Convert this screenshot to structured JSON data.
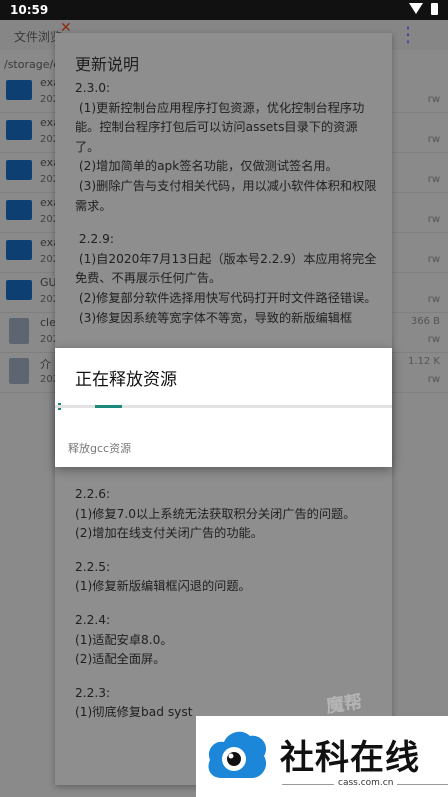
{
  "status_bar": {
    "time": "10:59"
  },
  "background": {
    "tab_label": "文件浏览",
    "path": "/storage/e",
    "rows": [
      {
        "name": "exa",
        "date": "202",
        "perm": "rw",
        "type": "folder",
        "size": ""
      },
      {
        "name": "exa",
        "date": "202",
        "perm": "rw",
        "type": "folder",
        "size": ""
      },
      {
        "name": "exa",
        "date": "202",
        "perm": "rw",
        "type": "folder",
        "size": ""
      },
      {
        "name": "exa",
        "date": "202",
        "perm": "rw",
        "type": "folder",
        "size": ""
      },
      {
        "name": "exa",
        "date": "202",
        "perm": "rw",
        "type": "folder",
        "size": ""
      },
      {
        "name": "GU",
        "date": "202",
        "perm": "rw",
        "type": "folder",
        "size": ""
      },
      {
        "name": "cle",
        "date": "202",
        "perm": "rw",
        "type": "code",
        "size": "366 B"
      },
      {
        "name": "介",
        "date": "202",
        "perm": "rw",
        "type": "file",
        "size": "1.12 K"
      }
    ]
  },
  "changelog": {
    "title": "更新说明",
    "upper_paragraphs": [
      {
        "gap": false,
        "text": "2.3.0:\n (1)更新控制台应用程序打包资源，优化控制台程序功能。控制台程序打包后可以访问assets目录下的资源了。\n (2)增加简单的apk签名功能，仅做测试签名用。\n (3)删除广告与支付相关代码，用以减小软件体积和权限需求。"
      },
      {
        "gap": true,
        "text": " 2.2.9:\n (1)自2020年7月13日起（版本号2.2.9）本应用将完全免费、不再展示任何广告。\n (2)修复部分软件选择用快写代码打开时文件路径错误。\n (3)修复因系统等宽字体不等宽，导致的新版编辑框"
      }
    ],
    "lower_paragraphs": [
      {
        "gap": false,
        "text": "2.2.6:"
      },
      {
        "gap": false,
        "text": "(1)修复7.0以上系统无法获取积分关闭广告的问题。"
      },
      {
        "gap": false,
        "text": "(2)增加在线支付关闭广告的功能。"
      },
      {
        "gap": true,
        "text": "2.2.5:"
      },
      {
        "gap": false,
        "text": "(1)修复新版编辑框闪退的问题。"
      },
      {
        "gap": true,
        "text": "2.2.4:"
      },
      {
        "gap": false,
        "text": "(1)适配安卓8.0。"
      },
      {
        "gap": false,
        "text": "(2)适配全面屏。"
      },
      {
        "gap": true,
        "text": "2.2.3:"
      },
      {
        "gap": false,
        "text": "(1)彻底修复bad syst"
      }
    ]
  },
  "progress_dialog": {
    "title": "正在释放资源",
    "message": "释放gcc资源",
    "progress_start": 0.12,
    "progress_end": 0.2,
    "accent_color": "#1b8a7a"
  },
  "watermark": {
    "brand": "社科在线",
    "site": "cass.com.cn",
    "faint_text": "魔帮"
  }
}
